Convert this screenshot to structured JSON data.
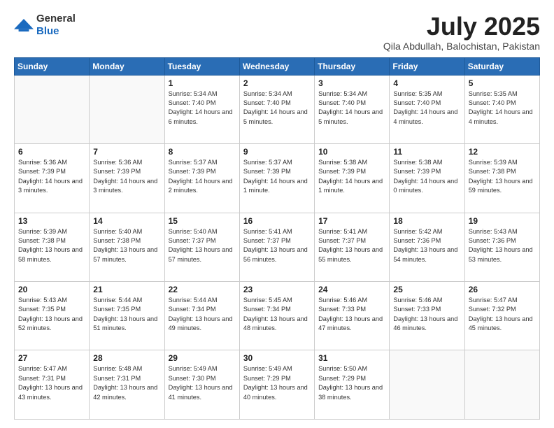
{
  "header": {
    "logo_general": "General",
    "logo_blue": "Blue",
    "title": "July 2025",
    "location": "Qila Abdullah, Balochistan, Pakistan"
  },
  "weekdays": [
    "Sunday",
    "Monday",
    "Tuesday",
    "Wednesday",
    "Thursday",
    "Friday",
    "Saturday"
  ],
  "weeks": [
    [
      {
        "day": "",
        "sunrise": "",
        "sunset": "",
        "daylight": ""
      },
      {
        "day": "",
        "sunrise": "",
        "sunset": "",
        "daylight": ""
      },
      {
        "day": "1",
        "sunrise": "Sunrise: 5:34 AM",
        "sunset": "Sunset: 7:40 PM",
        "daylight": "Daylight: 14 hours and 6 minutes."
      },
      {
        "day": "2",
        "sunrise": "Sunrise: 5:34 AM",
        "sunset": "Sunset: 7:40 PM",
        "daylight": "Daylight: 14 hours and 5 minutes."
      },
      {
        "day": "3",
        "sunrise": "Sunrise: 5:34 AM",
        "sunset": "Sunset: 7:40 PM",
        "daylight": "Daylight: 14 hours and 5 minutes."
      },
      {
        "day": "4",
        "sunrise": "Sunrise: 5:35 AM",
        "sunset": "Sunset: 7:40 PM",
        "daylight": "Daylight: 14 hours and 4 minutes."
      },
      {
        "day": "5",
        "sunrise": "Sunrise: 5:35 AM",
        "sunset": "Sunset: 7:40 PM",
        "daylight": "Daylight: 14 hours and 4 minutes."
      }
    ],
    [
      {
        "day": "6",
        "sunrise": "Sunrise: 5:36 AM",
        "sunset": "Sunset: 7:39 PM",
        "daylight": "Daylight: 14 hours and 3 minutes."
      },
      {
        "day": "7",
        "sunrise": "Sunrise: 5:36 AM",
        "sunset": "Sunset: 7:39 PM",
        "daylight": "Daylight: 14 hours and 3 minutes."
      },
      {
        "day": "8",
        "sunrise": "Sunrise: 5:37 AM",
        "sunset": "Sunset: 7:39 PM",
        "daylight": "Daylight: 14 hours and 2 minutes."
      },
      {
        "day": "9",
        "sunrise": "Sunrise: 5:37 AM",
        "sunset": "Sunset: 7:39 PM",
        "daylight": "Daylight: 14 hours and 1 minute."
      },
      {
        "day": "10",
        "sunrise": "Sunrise: 5:38 AM",
        "sunset": "Sunset: 7:39 PM",
        "daylight": "Daylight: 14 hours and 1 minute."
      },
      {
        "day": "11",
        "sunrise": "Sunrise: 5:38 AM",
        "sunset": "Sunset: 7:39 PM",
        "daylight": "Daylight: 14 hours and 0 minutes."
      },
      {
        "day": "12",
        "sunrise": "Sunrise: 5:39 AM",
        "sunset": "Sunset: 7:38 PM",
        "daylight": "Daylight: 13 hours and 59 minutes."
      }
    ],
    [
      {
        "day": "13",
        "sunrise": "Sunrise: 5:39 AM",
        "sunset": "Sunset: 7:38 PM",
        "daylight": "Daylight: 13 hours and 58 minutes."
      },
      {
        "day": "14",
        "sunrise": "Sunrise: 5:40 AM",
        "sunset": "Sunset: 7:38 PM",
        "daylight": "Daylight: 13 hours and 57 minutes."
      },
      {
        "day": "15",
        "sunrise": "Sunrise: 5:40 AM",
        "sunset": "Sunset: 7:37 PM",
        "daylight": "Daylight: 13 hours and 57 minutes."
      },
      {
        "day": "16",
        "sunrise": "Sunrise: 5:41 AM",
        "sunset": "Sunset: 7:37 PM",
        "daylight": "Daylight: 13 hours and 56 minutes."
      },
      {
        "day": "17",
        "sunrise": "Sunrise: 5:41 AM",
        "sunset": "Sunset: 7:37 PM",
        "daylight": "Daylight: 13 hours and 55 minutes."
      },
      {
        "day": "18",
        "sunrise": "Sunrise: 5:42 AM",
        "sunset": "Sunset: 7:36 PM",
        "daylight": "Daylight: 13 hours and 54 minutes."
      },
      {
        "day": "19",
        "sunrise": "Sunrise: 5:43 AM",
        "sunset": "Sunset: 7:36 PM",
        "daylight": "Daylight: 13 hours and 53 minutes."
      }
    ],
    [
      {
        "day": "20",
        "sunrise": "Sunrise: 5:43 AM",
        "sunset": "Sunset: 7:35 PM",
        "daylight": "Daylight: 13 hours and 52 minutes."
      },
      {
        "day": "21",
        "sunrise": "Sunrise: 5:44 AM",
        "sunset": "Sunset: 7:35 PM",
        "daylight": "Daylight: 13 hours and 51 minutes."
      },
      {
        "day": "22",
        "sunrise": "Sunrise: 5:44 AM",
        "sunset": "Sunset: 7:34 PM",
        "daylight": "Daylight: 13 hours and 49 minutes."
      },
      {
        "day": "23",
        "sunrise": "Sunrise: 5:45 AM",
        "sunset": "Sunset: 7:34 PM",
        "daylight": "Daylight: 13 hours and 48 minutes."
      },
      {
        "day": "24",
        "sunrise": "Sunrise: 5:46 AM",
        "sunset": "Sunset: 7:33 PM",
        "daylight": "Daylight: 13 hours and 47 minutes."
      },
      {
        "day": "25",
        "sunrise": "Sunrise: 5:46 AM",
        "sunset": "Sunset: 7:33 PM",
        "daylight": "Daylight: 13 hours and 46 minutes."
      },
      {
        "day": "26",
        "sunrise": "Sunrise: 5:47 AM",
        "sunset": "Sunset: 7:32 PM",
        "daylight": "Daylight: 13 hours and 45 minutes."
      }
    ],
    [
      {
        "day": "27",
        "sunrise": "Sunrise: 5:47 AM",
        "sunset": "Sunset: 7:31 PM",
        "daylight": "Daylight: 13 hours and 43 minutes."
      },
      {
        "day": "28",
        "sunrise": "Sunrise: 5:48 AM",
        "sunset": "Sunset: 7:31 PM",
        "daylight": "Daylight: 13 hours and 42 minutes."
      },
      {
        "day": "29",
        "sunrise": "Sunrise: 5:49 AM",
        "sunset": "Sunset: 7:30 PM",
        "daylight": "Daylight: 13 hours and 41 minutes."
      },
      {
        "day": "30",
        "sunrise": "Sunrise: 5:49 AM",
        "sunset": "Sunset: 7:29 PM",
        "daylight": "Daylight: 13 hours and 40 minutes."
      },
      {
        "day": "31",
        "sunrise": "Sunrise: 5:50 AM",
        "sunset": "Sunset: 7:29 PM",
        "daylight": "Daylight: 13 hours and 38 minutes."
      },
      {
        "day": "",
        "sunrise": "",
        "sunset": "",
        "daylight": ""
      },
      {
        "day": "",
        "sunrise": "",
        "sunset": "",
        "daylight": ""
      }
    ]
  ]
}
